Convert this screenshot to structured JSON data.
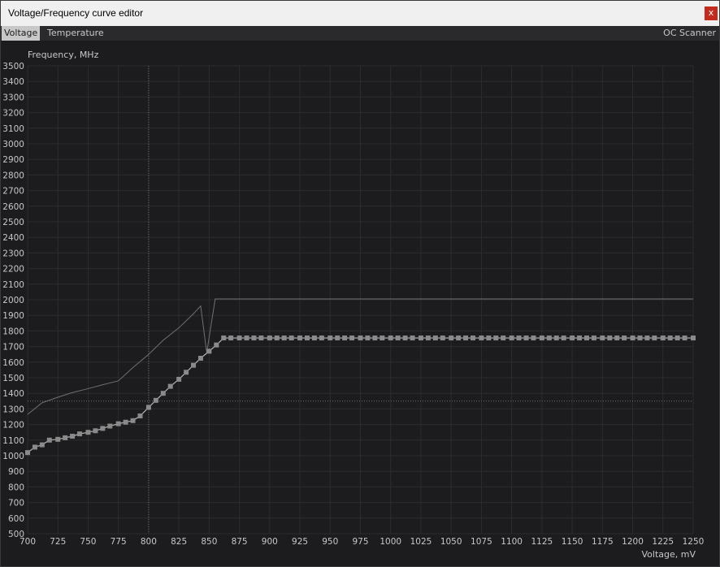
{
  "window": {
    "title": "Voltage/Frequency curve editor",
    "close_label": "x"
  },
  "tabs": {
    "voltage": "Voltage",
    "temperature": "Temperature",
    "oc_scanner": "OC Scanner"
  },
  "chart_data": {
    "type": "line",
    "ylabel": "Frequency, MHz",
    "xlabel": "Voltage, mV",
    "xlim": [
      700,
      1250
    ],
    "ylim": [
      500,
      3500
    ],
    "x_ticks": [
      700,
      725,
      750,
      775,
      800,
      825,
      850,
      875,
      900,
      925,
      950,
      975,
      1000,
      1025,
      1050,
      1075,
      1100,
      1125,
      1150,
      1175,
      1200,
      1225,
      1250
    ],
    "y_ticks": [
      500,
      600,
      700,
      800,
      900,
      1000,
      1100,
      1200,
      1300,
      1400,
      1500,
      1600,
      1700,
      1800,
      1900,
      2000,
      2100,
      2200,
      2300,
      2400,
      2500,
      2600,
      2700,
      2800,
      2900,
      3000,
      3100,
      3200,
      3300,
      3400,
      3500
    ],
    "grid": true,
    "crosshair": {
      "voltage": 800,
      "frequency": 1350
    },
    "colors": {
      "background": "#1c1c1e",
      "grid": "#2c2c2e",
      "points": "#8a8a8a",
      "curve": "#b4b4b4",
      "reference": "#707070"
    },
    "series": [
      {
        "role": "reference-curve",
        "x": [
          700,
          712,
          725,
          737,
          750,
          762,
          775,
          787,
          800,
          812,
          825,
          837,
          843,
          848,
          855,
          1250
        ],
        "y": [
          1265,
          1340,
          1375,
          1405,
          1430,
          1455,
          1480,
          1565,
          1650,
          1740,
          1820,
          1910,
          1960,
          1660,
          2005,
          2005
        ]
      },
      {
        "role": "vf-curve",
        "x": [
          700,
          706,
          712,
          718,
          725,
          731,
          737,
          743,
          750,
          756,
          762,
          768,
          775,
          781,
          787,
          793,
          800,
          806,
          812,
          818,
          825,
          831,
          837,
          843,
          850,
          856,
          862,
          868,
          875,
          881,
          887,
          893,
          900,
          906,
          912,
          918,
          925,
          931,
          937,
          943,
          950,
          956,
          962,
          968,
          975,
          981,
          987,
          993,
          1000,
          1006,
          1012,
          1018,
          1025,
          1031,
          1037,
          1043,
          1050,
          1056,
          1062,
          1068,
          1075,
          1081,
          1087,
          1093,
          1100,
          1106,
          1112,
          1118,
          1125,
          1131,
          1137,
          1143,
          1150,
          1156,
          1162,
          1168,
          1175,
          1181,
          1187,
          1193,
          1200,
          1206,
          1212,
          1218,
          1225,
          1231,
          1237,
          1243,
          1250
        ],
        "y": [
          1020,
          1055,
          1070,
          1100,
          1105,
          1115,
          1125,
          1140,
          1150,
          1160,
          1175,
          1190,
          1205,
          1215,
          1225,
          1255,
          1310,
          1355,
          1400,
          1445,
          1490,
          1535,
          1580,
          1625,
          1670,
          1710,
          1755,
          1755,
          1755,
          1755,
          1755,
          1755,
          1755,
          1755,
          1755,
          1755,
          1755,
          1755,
          1755,
          1755,
          1755,
          1755,
          1755,
          1755,
          1755,
          1755,
          1755,
          1755,
          1755,
          1755,
          1755,
          1755,
          1755,
          1755,
          1755,
          1755,
          1755,
          1755,
          1755,
          1755,
          1755,
          1755,
          1755,
          1755,
          1755,
          1755,
          1755,
          1755,
          1755,
          1755,
          1755,
          1755,
          1755,
          1755,
          1755,
          1755,
          1755,
          1755,
          1755,
          1755,
          1755,
          1755,
          1755,
          1755,
          1755,
          1755,
          1755,
          1755,
          1755
        ]
      }
    ]
  }
}
